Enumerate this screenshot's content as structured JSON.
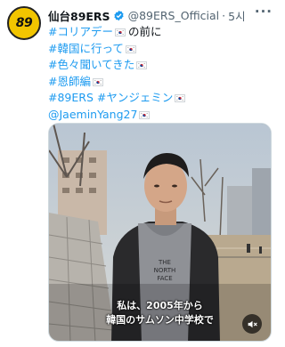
{
  "tweet": {
    "avatar_logo_text": "89",
    "display_name": "仙台89ERS",
    "handle": "@89ERS_Official",
    "separator": "·",
    "time": "5시",
    "more_label": "···",
    "lines": [
      {
        "text": "#コリアデー",
        "rest": "の前に",
        "flag": true
      },
      {
        "text": "#韓国に行って",
        "rest": "",
        "flag": true
      },
      {
        "text": "#色々聞いてきた",
        "rest": "",
        "flag": true
      },
      {
        "text": "#恩師編",
        "rest": "",
        "flag": true
      },
      {
        "text": "#89ERS #ヤンジェミン",
        "rest": "",
        "flag": true
      },
      {
        "text": "@JaeminYang27",
        "rest": "",
        "flag": true
      }
    ],
    "media": {
      "subtitle_line1": "私は、2005年から",
      "subtitle_line2": "韓国のサムソン中学校で",
      "mute_icon": "speaker-muted-icon"
    }
  },
  "colors": {
    "link": "#1d9bf0",
    "secondary_text": "#536471",
    "verified": "#1d9bf0",
    "avatar_bg": "#f2c500"
  }
}
